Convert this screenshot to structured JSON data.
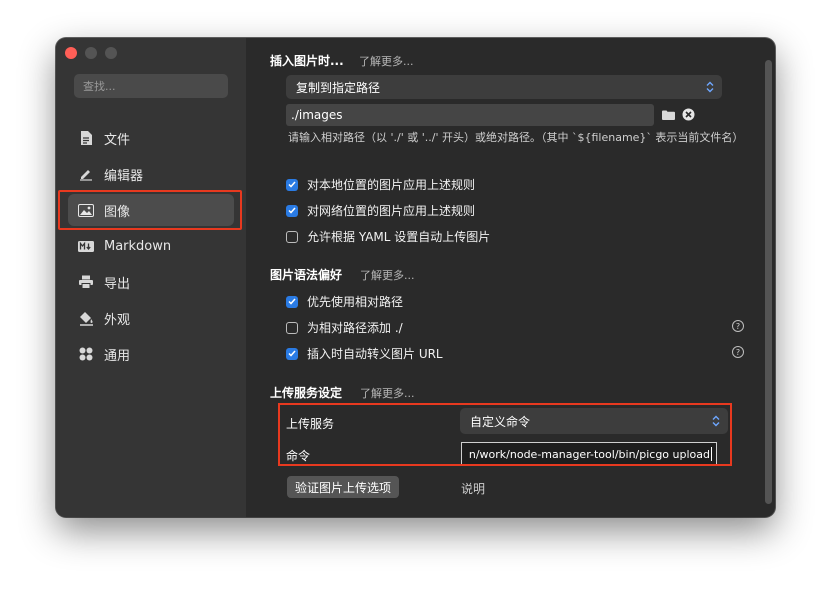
{
  "sidebar": {
    "search_placeholder": "查找...",
    "items": [
      {
        "label": "文件",
        "icon": "file-icon"
      },
      {
        "label": "编辑器",
        "icon": "pencil-icon"
      },
      {
        "label": "图像",
        "icon": "image-icon",
        "active": true
      },
      {
        "label": "Markdown",
        "icon": "markdown-icon"
      },
      {
        "label": "导出",
        "icon": "printer-icon"
      },
      {
        "label": "外观",
        "icon": "paint-bucket-icon"
      },
      {
        "label": "通用",
        "icon": "grid-icon"
      }
    ]
  },
  "insert_image": {
    "title": "插入图片时...",
    "learn_more": "了解更多...",
    "action_select": "复制到指定路径",
    "path_value": "./images",
    "hint": "请输入相对路径（以 './' 或 '../' 开头）或绝对路径。（其中 `${filename}` 表示当前文件名）",
    "checks": [
      {
        "label": "对本地位置的图片应用上述规则",
        "checked": true
      },
      {
        "label": "对网络位置的图片应用上述规则",
        "checked": true
      },
      {
        "label": "允许根据 YAML 设置自动上传图片",
        "checked": false
      }
    ]
  },
  "syntax_pref": {
    "title": "图片语法偏好",
    "learn_more": "了解更多...",
    "checks": [
      {
        "label": "优先使用相对路径",
        "checked": true,
        "help": false
      },
      {
        "label": "为相对路径添加 ./",
        "checked": false,
        "help": true
      },
      {
        "label": "插入时自动转义图片 URL",
        "checked": true,
        "help": true
      }
    ],
    "help_glyph": "?"
  },
  "upload": {
    "title": "上传服务设定",
    "learn_more": "了解更多...",
    "service_label": "上传服务",
    "service_value": "自定义命令",
    "command_label": "命令",
    "command_value": "n/work/node-manager-tool/bin/picgo upload",
    "validate_button": "验证图片上传选项",
    "explain_link": "说明"
  },
  "colors": {
    "accent_blue": "#2a7be4",
    "highlight_red": "#e8391f",
    "window_bg": "#2a2a2a",
    "sidebar_bg": "#353535"
  }
}
